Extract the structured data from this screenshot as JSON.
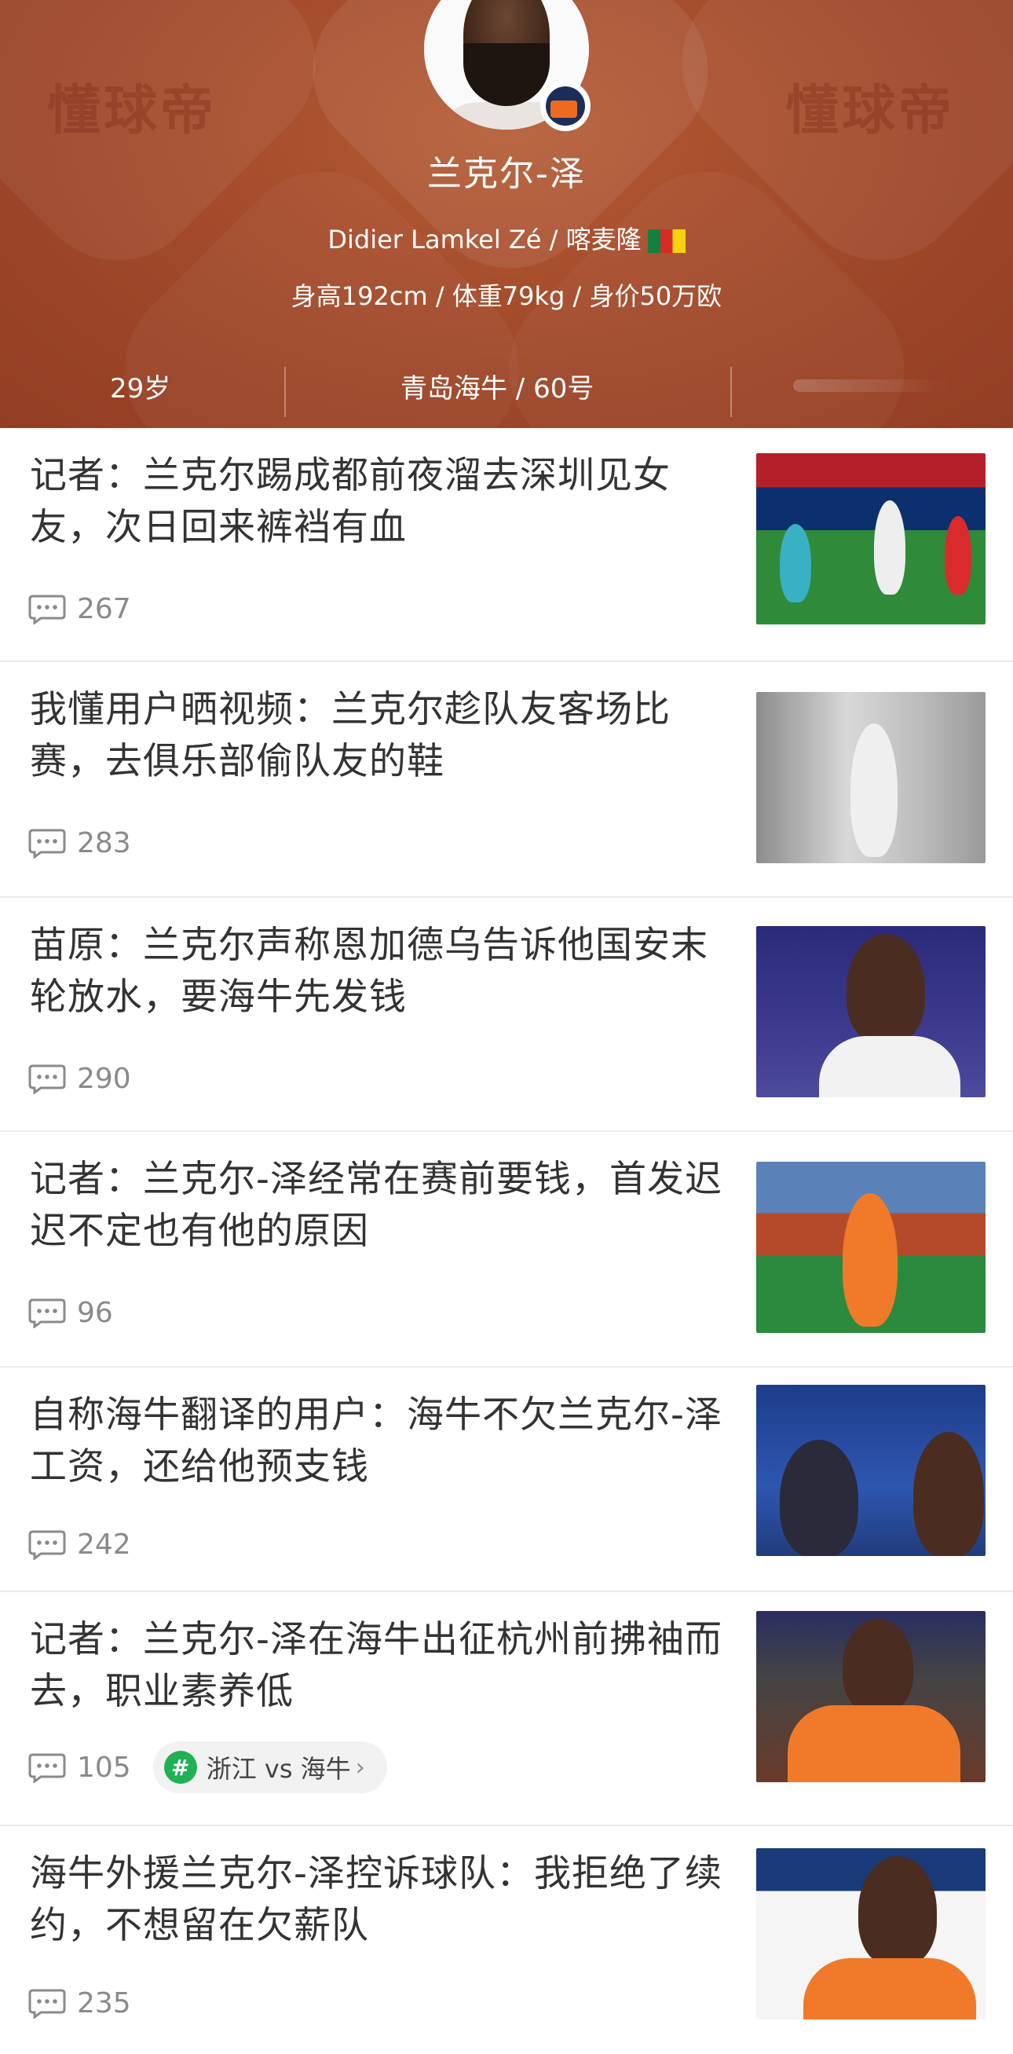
{
  "header": {
    "watermark": "懂球帝",
    "name": "兰克尔-泽",
    "subtitle": "Didier Lamkel Zé / 喀麦隆",
    "body_info": "身高192cm / 体重79kg / 身价50万欧",
    "age": "29岁",
    "team": "青岛海牛 / 60号"
  },
  "news": [
    {
      "title": "记者：兰克尔踢成都前夜溜去深圳见女友，次日回来裤裆有血",
      "comments": "267"
    },
    {
      "title": "我懂用户晒视频：兰克尔趁队友客场比赛，去俱乐部偷队友的鞋",
      "comments": "283"
    },
    {
      "title": "苗原：兰克尔声称恩加德乌告诉他国安末轮放水，要海牛先发钱",
      "comments": "290"
    },
    {
      "title": "记者：兰克尔-泽经常在赛前要钱，首发迟迟不定也有他的原因",
      "comments": "96"
    },
    {
      "title": "自称海牛翻译的用户：海牛不欠兰克尔-泽工资，还给他预支钱",
      "comments": "242"
    },
    {
      "title": "记者：兰克尔-泽在海牛出征杭州前拂袖而去，职业素养低",
      "comments": "105",
      "tag": "浙江 vs 海牛"
    },
    {
      "title": "海牛外援兰克尔-泽控诉球队：我拒绝了续约，不想留在欠薪队",
      "comments": "235"
    }
  ],
  "colors": {
    "header_bg": "#a0482a",
    "tag_green": "#1fb154",
    "text_dark": "#333333",
    "text_gray": "#8a8a8a"
  },
  "icons": {
    "comment": "comment-bubble-icon",
    "tag": "hashtag-icon",
    "chevron": "chevron-right-icon"
  }
}
